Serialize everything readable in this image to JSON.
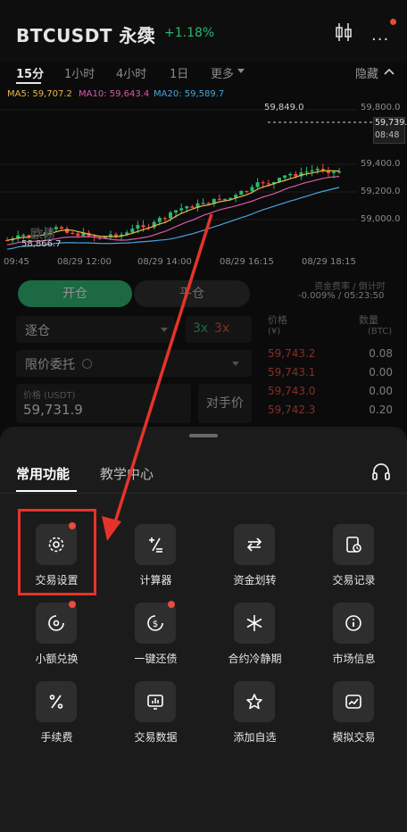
{
  "header": {
    "symbol": "BTCUSDT 永续",
    "change": "+1.18%",
    "icons": [
      "candlestick-icon",
      "more-icon"
    ]
  },
  "intervals": {
    "items": [
      "15分",
      "1小时",
      "4小时",
      "1日",
      "更多"
    ],
    "active": "15分",
    "hide_label": "隐藏"
  },
  "chart": {
    "ma": [
      "MA5: 59,707.2",
      "MA10: 59,643.4",
      "MA20: 59,589.7"
    ],
    "ma_colors": [
      "#e8b84a",
      "#d85aa8",
      "#4aa3df"
    ],
    "price_axis": [
      "59,800.0",
      "59,600.0",
      "59,400.0",
      "59,200.0",
      "59,000.0"
    ],
    "high_label": "59,849.0",
    "low_label": "58,866.7",
    "last_price": "59,739.9",
    "countdown": "08:48",
    "time_axis": [
      "09:45",
      "08/29 12:00",
      "08/29 14:00",
      "08/29 16:15",
      "08/29 18:15"
    ],
    "watermark": "欧易"
  },
  "form": {
    "open_tab": "开仓",
    "close_tab": "平仓",
    "funding_label": "资金费率 / 倒计时",
    "funding_value": "-0.009% / 05:23:50",
    "margin_mode": "逐仓",
    "lev_long": "3x",
    "lev_short": "3x",
    "order_type": "限价委托",
    "price_label": "价格 (USDT)",
    "price_value": "59,731.9",
    "counterparty": "对手价",
    "book_price_hdr": "价格",
    "book_price_unit": "(¥)",
    "book_qty_hdr": "数量",
    "book_qty_unit": "(BTC)",
    "asks": [
      {
        "price": "59,743.2",
        "qty": "0.08"
      },
      {
        "price": "59,743.1",
        "qty": "0.00"
      },
      {
        "price": "59,743.0",
        "qty": "0.00"
      },
      {
        "price": "59,742.3",
        "qty": "0.20"
      }
    ]
  },
  "sheet": {
    "tabs": [
      "常用功能",
      "教学中心"
    ],
    "tools": [
      {
        "label": "交易设置",
        "icon": "gear-icon",
        "dot": true
      },
      {
        "label": "计算器",
        "icon": "calculator-icon",
        "dot": false
      },
      {
        "label": "资金划转",
        "icon": "transfer-icon",
        "dot": false
      },
      {
        "label": "交易记录",
        "icon": "history-icon",
        "dot": false
      },
      {
        "label": "小额兑换",
        "icon": "small-exchange-icon",
        "dot": true
      },
      {
        "label": "一键还债",
        "icon": "repay-icon",
        "dot": true
      },
      {
        "label": "合约冷静期",
        "icon": "snowflake-icon",
        "dot": false
      },
      {
        "label": "市场信息",
        "icon": "info-icon",
        "dot": false
      },
      {
        "label": "手续费",
        "icon": "percent-icon",
        "dot": false
      },
      {
        "label": "交易数据",
        "icon": "data-icon",
        "dot": false
      },
      {
        "label": "添加自选",
        "icon": "star-icon",
        "dot": false
      },
      {
        "label": "模拟交易",
        "icon": "demo-trade-icon",
        "dot": false
      }
    ]
  },
  "colors": {
    "up": "#2bb673",
    "down": "#e94b3c",
    "highlight": "#e6332a"
  }
}
